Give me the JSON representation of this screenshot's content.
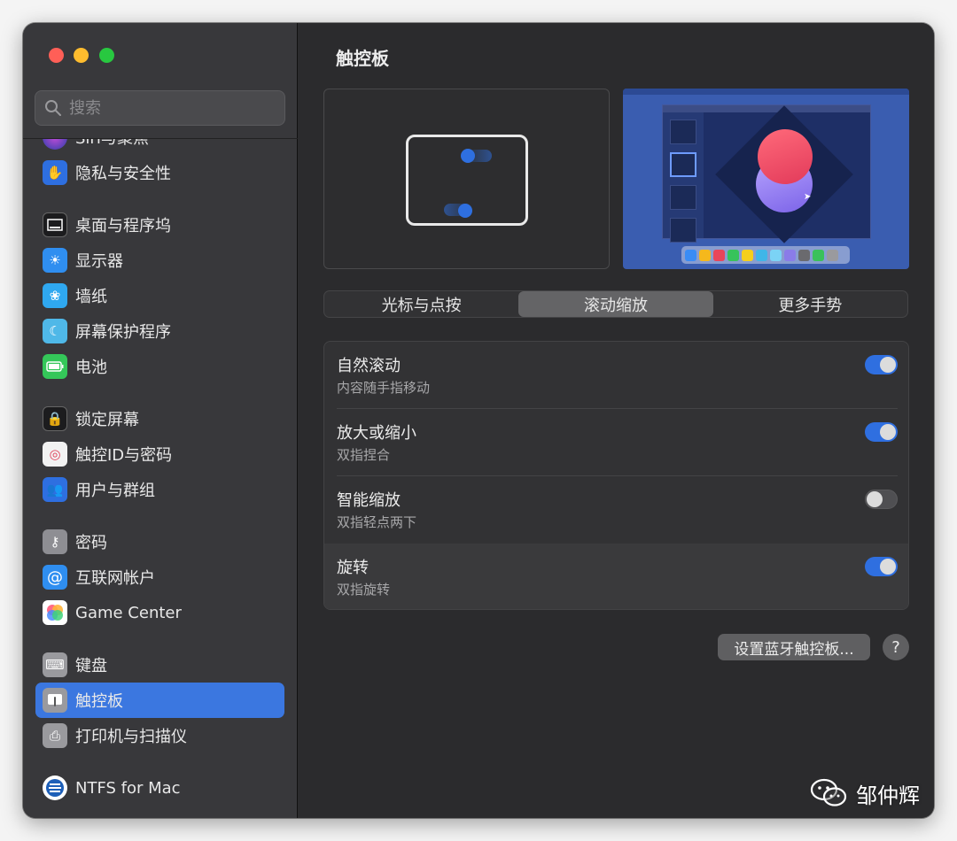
{
  "window": {
    "title": "触控板"
  },
  "search": {
    "placeholder": "搜索"
  },
  "sidebar": {
    "items": [
      {
        "label": "Siri与聚焦",
        "icon": "siri-icon",
        "color": "#3a3a8c"
      },
      {
        "label": "隐私与安全性",
        "icon": "hand-icon",
        "color": "#2e6fe0"
      },
      {
        "label": "桌面与程序坞",
        "icon": "dock-icon",
        "color": "#1c1c1e"
      },
      {
        "label": "显示器",
        "icon": "sun-icon",
        "color": "#2f8ef0"
      },
      {
        "label": "墙纸",
        "icon": "flower-icon",
        "color": "#2fa8f0"
      },
      {
        "label": "屏幕保护程序",
        "icon": "screensaver-icon",
        "color": "#4fb8e8"
      },
      {
        "label": "电池",
        "icon": "battery-icon",
        "color": "#34c759"
      },
      {
        "label": "锁定屏幕",
        "icon": "lock-icon",
        "color": "#1c1c1e"
      },
      {
        "label": "触控ID与密码",
        "icon": "fingerprint-icon",
        "color": "#f2f2f2"
      },
      {
        "label": "用户与群组",
        "icon": "users-icon",
        "color": "#2e6fe0"
      },
      {
        "label": "密码",
        "icon": "key-icon",
        "color": "#8e8e93"
      },
      {
        "label": "互联网帐户",
        "icon": "at-icon",
        "color": "#2f8ef0"
      },
      {
        "label": "Game Center",
        "icon": "game-center-icon",
        "color": "#ffffff"
      },
      {
        "label": "键盘",
        "icon": "keyboard-icon",
        "color": "#9a9a9e"
      },
      {
        "label": "触控板",
        "icon": "trackpad-icon",
        "color": "#9a9a9e"
      },
      {
        "label": "打印机与扫描仪",
        "icon": "printer-icon",
        "color": "#9a9a9e"
      },
      {
        "label": "NTFS for Mac",
        "icon": "ntfs-icon",
        "color": "#1d5fb8"
      }
    ],
    "selected": "触控板"
  },
  "preview": {
    "accent": "#2e6fe0"
  },
  "tabs": [
    {
      "label": "光标与点按"
    },
    {
      "label": "滚动缩放",
      "active": true
    },
    {
      "label": "更多手势"
    }
  ],
  "settings": [
    {
      "title": "自然滚动",
      "subtitle": "内容随手指移动",
      "on": true
    },
    {
      "title": "放大或缩小",
      "subtitle": "双指捏合",
      "on": true
    },
    {
      "title": "智能缩放",
      "subtitle": "双指轻点两下",
      "on": false
    },
    {
      "title": "旋转",
      "subtitle": "双指旋转",
      "on": true
    }
  ],
  "footer": {
    "bluetooth_button": "设置蓝牙触控板...",
    "help_button": "?"
  },
  "watermark": {
    "text": "邹仲辉"
  },
  "colors": {
    "accent": "#2f6fe0",
    "sidebar_selected": "#3b77e0"
  }
}
